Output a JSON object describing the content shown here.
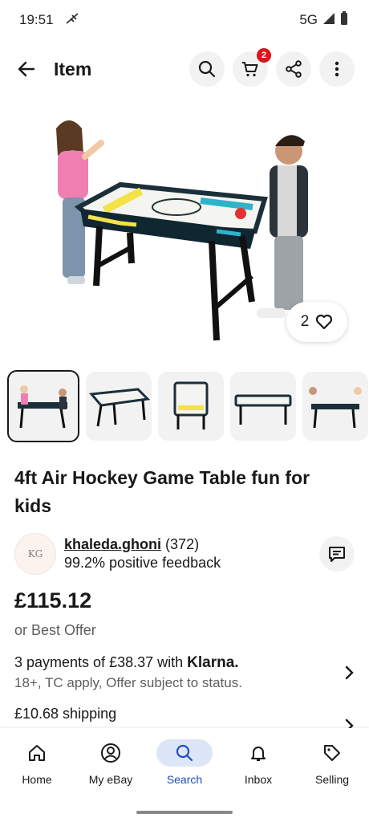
{
  "status": {
    "time": "19:51",
    "network": "5G"
  },
  "header": {
    "title": "Item",
    "cart_count": "2"
  },
  "watchers": {
    "count": "2"
  },
  "listing": {
    "title": "4ft Air Hockey Game Table fun for kids"
  },
  "seller": {
    "avatar_initials": "KG",
    "name": "khaleda.ghoni",
    "rating_count": "(372)",
    "feedback": "99.2% positive feedback"
  },
  "price": {
    "amount": "£115.12",
    "best_offer": "or Best Offer"
  },
  "klarna": {
    "line1_prefix": "3 payments of £38.37 with",
    "brand": "Klarna.",
    "line2": "18+, TC apply, Offer subject to status."
  },
  "shipping": {
    "text": "£10.68 shipping"
  },
  "nav": {
    "items": [
      {
        "label": "Home",
        "icon": "home-icon"
      },
      {
        "label": "My eBay",
        "icon": "person-icon"
      },
      {
        "label": "Search",
        "icon": "search-icon"
      },
      {
        "label": "Inbox",
        "icon": "bell-icon"
      },
      {
        "label": "Selling",
        "icon": "tag-icon"
      }
    ],
    "active": "Search"
  },
  "colors": {
    "badge": "#e0121c",
    "active_nav": "#1a4fc4",
    "active_nav_bg": "#dde6f7"
  }
}
